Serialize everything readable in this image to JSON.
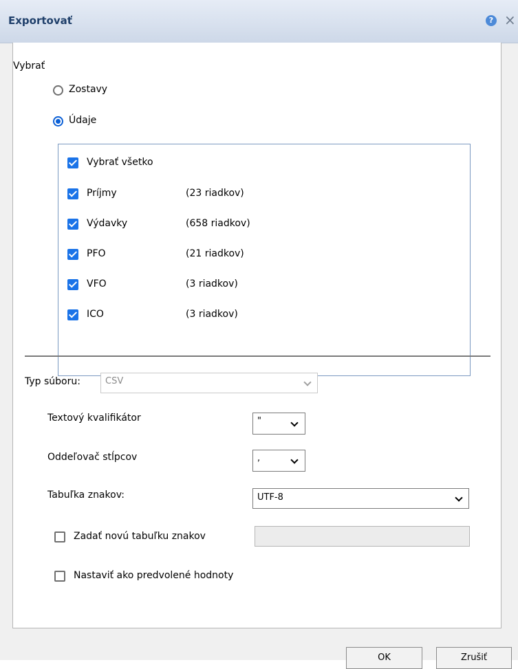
{
  "window": {
    "title": "Exportovať",
    "help_icon": "?",
    "close_icon": "×"
  },
  "select_section": {
    "label": "Vybrať",
    "options": [
      {
        "label": "Zostavy",
        "checked": false
      },
      {
        "label": "Údaje",
        "checked": true
      }
    ]
  },
  "data_items": {
    "select_all_label": "Vybrať všetko",
    "items": [
      {
        "label": "Príjmy",
        "rows": "(23 riadkov)"
      },
      {
        "label": "Výdavky",
        "rows": "(658 riadkov)"
      },
      {
        "label": "PFO",
        "rows": "(21 riadkov)"
      },
      {
        "label": "VFO",
        "rows": "(3 riadkov)"
      },
      {
        "label": "ICO",
        "rows": "(3 riadkov)"
      }
    ]
  },
  "file_type": {
    "label": "Typ súboru:",
    "value": "CSV"
  },
  "text_qualifier": {
    "label": "Textový kvalifikátor",
    "value": "\""
  },
  "column_separator": {
    "label": "Oddeľovač stĺpcov",
    "value": ","
  },
  "charset": {
    "label": "Tabuľka znakov:",
    "value": "UTF-8"
  },
  "new_charset": {
    "label": "Zadať novú tabuľku znakov",
    "value": ""
  },
  "set_default": {
    "label": "Nastaviť ako predvolené hodnoty"
  },
  "buttons": {
    "ok": "OK",
    "cancel": "Zrušiť"
  },
  "colors": {
    "accent": "#1a73e8",
    "title_text": "#1f3f6a"
  }
}
